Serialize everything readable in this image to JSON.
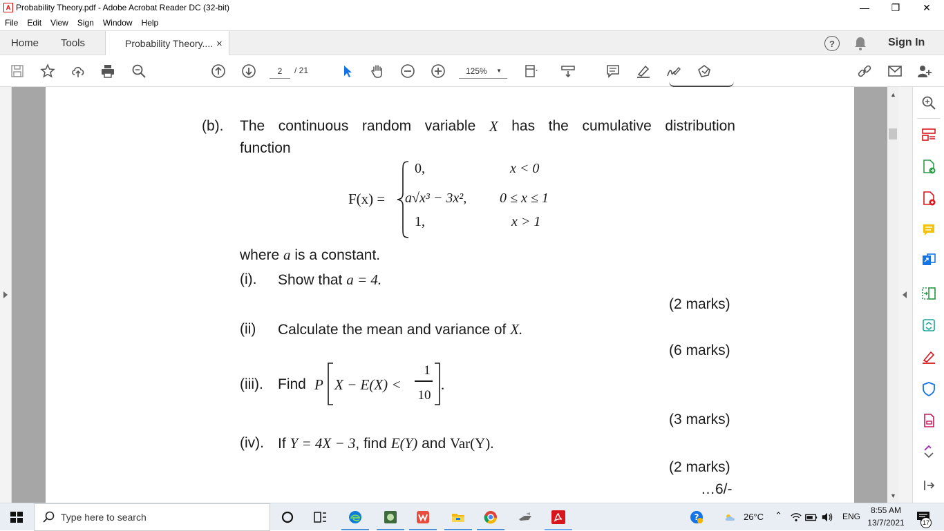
{
  "window": {
    "title": "Probability Theory.pdf - Adobe Acrobat Reader DC (32-bit)",
    "controls": [
      "—",
      "❐",
      "✕"
    ]
  },
  "menu": [
    "File",
    "Edit",
    "View",
    "Sign",
    "Window",
    "Help"
  ],
  "tabs": {
    "home": "Home",
    "tools": "Tools",
    "document": "Probability Theory....",
    "close": "×",
    "sign_in": "Sign In",
    "help": "?"
  },
  "toolbar": {
    "page_current": "2",
    "page_total": "/ 21",
    "zoom": "125%"
  },
  "document": {
    "label_b": "(b).",
    "intro_words": [
      "The",
      "continuous",
      "random",
      "variable",
      "X",
      "has",
      "the",
      "cumulative",
      "distribution"
    ],
    "intro_line2": "function",
    "fx": "F(x) =",
    "cases": [
      {
        "expr": "0,",
        "cond": "x < 0"
      },
      {
        "expr": "a√x³ − 3x²,",
        "cond": "0 ≤ x ≤ 1"
      },
      {
        "expr": "1,",
        "cond": "x > 1"
      }
    ],
    "where_pre": "where",
    "where_var": "a",
    "where_post": "is a constant.",
    "q1_label": "(i).",
    "q1_text": "Show that",
    "q1_math": "a = 4.",
    "q1_marks": "(2 marks)",
    "q2_label": "(ii)",
    "q2_text": "Calculate the mean and variance of",
    "q2_math": "X.",
    "q2_marks": "(6 marks)",
    "q3_label": "(iii).",
    "q3_text": "Find",
    "q3_math_pre": "P",
    "q3_math_body": "X − E(X) <",
    "q3_frac_num": "1",
    "q3_frac_den": "10",
    "q3_end": ".",
    "q3_marks": "(3 marks)",
    "q4_label": "(iv).",
    "q4_if": "If",
    "q4_math1": "Y = 4X − 3",
    "q4_find": ", find",
    "q4_math2": "E(Y)",
    "q4_and": "and",
    "q4_math3": "Var(Y)",
    "q4_end": ".",
    "q4_marks": "(2 marks)",
    "page_next": "…6/-"
  },
  "taskbar": {
    "search_placeholder": "Type here to search",
    "temperature": "26°C",
    "language": "ENG",
    "time": "8:55 AM",
    "date": "13/7/2021",
    "notifications": "17"
  },
  "colors": {
    "accent_blue": "#1473e6",
    "acrobat_red": "#d7161d",
    "page_gray": "#a6a6a6"
  }
}
